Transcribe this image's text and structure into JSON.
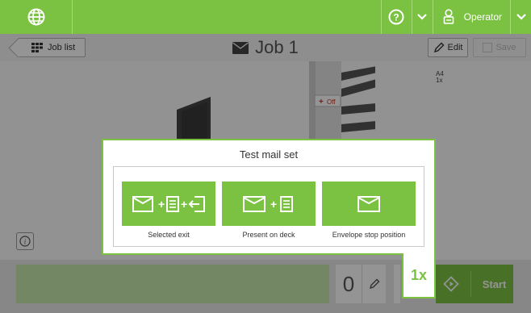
{
  "topbar": {
    "globe_icon": "globe-icon",
    "help_icon": "question-circle-icon",
    "operator_label": "Operator",
    "operator_icon": "user-badge-icon"
  },
  "subbar": {
    "job_list_label": "Job list",
    "job_title": "Job 1",
    "edit_label": "Edit",
    "save_label": "Save"
  },
  "machine": {
    "feeder_state": "Off",
    "media_line1": "A4",
    "media_line2": "1x"
  },
  "bottom": {
    "count": "0",
    "start_label": "Start"
  },
  "dialog": {
    "title": "Test mail set",
    "multiplier": "1x",
    "options": [
      {
        "label": "Selected exit"
      },
      {
        "label": "Present on deck"
      },
      {
        "label": "Envelope stop position"
      }
    ]
  },
  "colors": {
    "accent": "#7cc242",
    "overlay": "#00000069"
  }
}
